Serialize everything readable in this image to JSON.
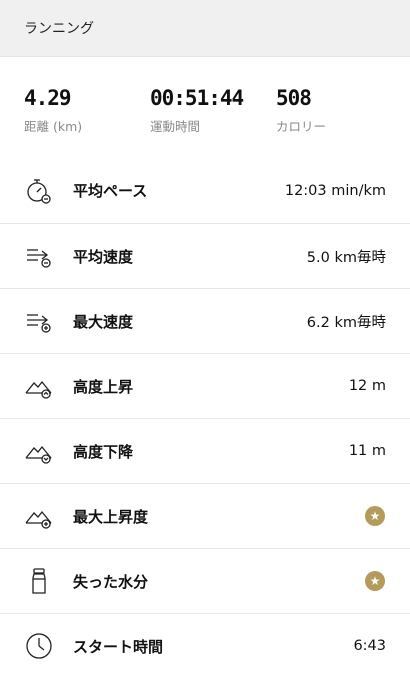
{
  "header": {
    "title": "ランニング"
  },
  "stats": [
    {
      "value": "4.29",
      "label": "距離 (km)"
    },
    {
      "value": "00:51:44",
      "label": "運動時間"
    },
    {
      "value": "508",
      "label": "カロリー"
    }
  ],
  "rows": [
    {
      "label": "平均ペース",
      "value": "12:03 min/km",
      "icon": "stopwatch-icon"
    },
    {
      "label": "平均速度",
      "value": "5.0 km毎時",
      "icon": "speed-average-icon"
    },
    {
      "label": "最大速度",
      "value": "6.2 km毎時",
      "icon": "speed-max-icon"
    },
    {
      "label": "高度上昇",
      "value": "12 m",
      "icon": "elevation-up-icon"
    },
    {
      "label": "高度下降",
      "value": "11 m",
      "icon": "elevation-down-icon"
    },
    {
      "label": "最大上昇度",
      "value": "",
      "icon": "max-elevation-icon",
      "badge": "star-badge"
    },
    {
      "label": "失った水分",
      "value": "",
      "icon": "bottle-icon",
      "badge": "star-badge"
    },
    {
      "label": "スタート時間",
      "value": "6:43",
      "icon": "clock-icon"
    }
  ],
  "colors": {
    "badge": "#b49a5b",
    "divider": "#e6e6e6",
    "header_bg": "#f0f0f0",
    "label_gray": "#8a8a8a"
  }
}
